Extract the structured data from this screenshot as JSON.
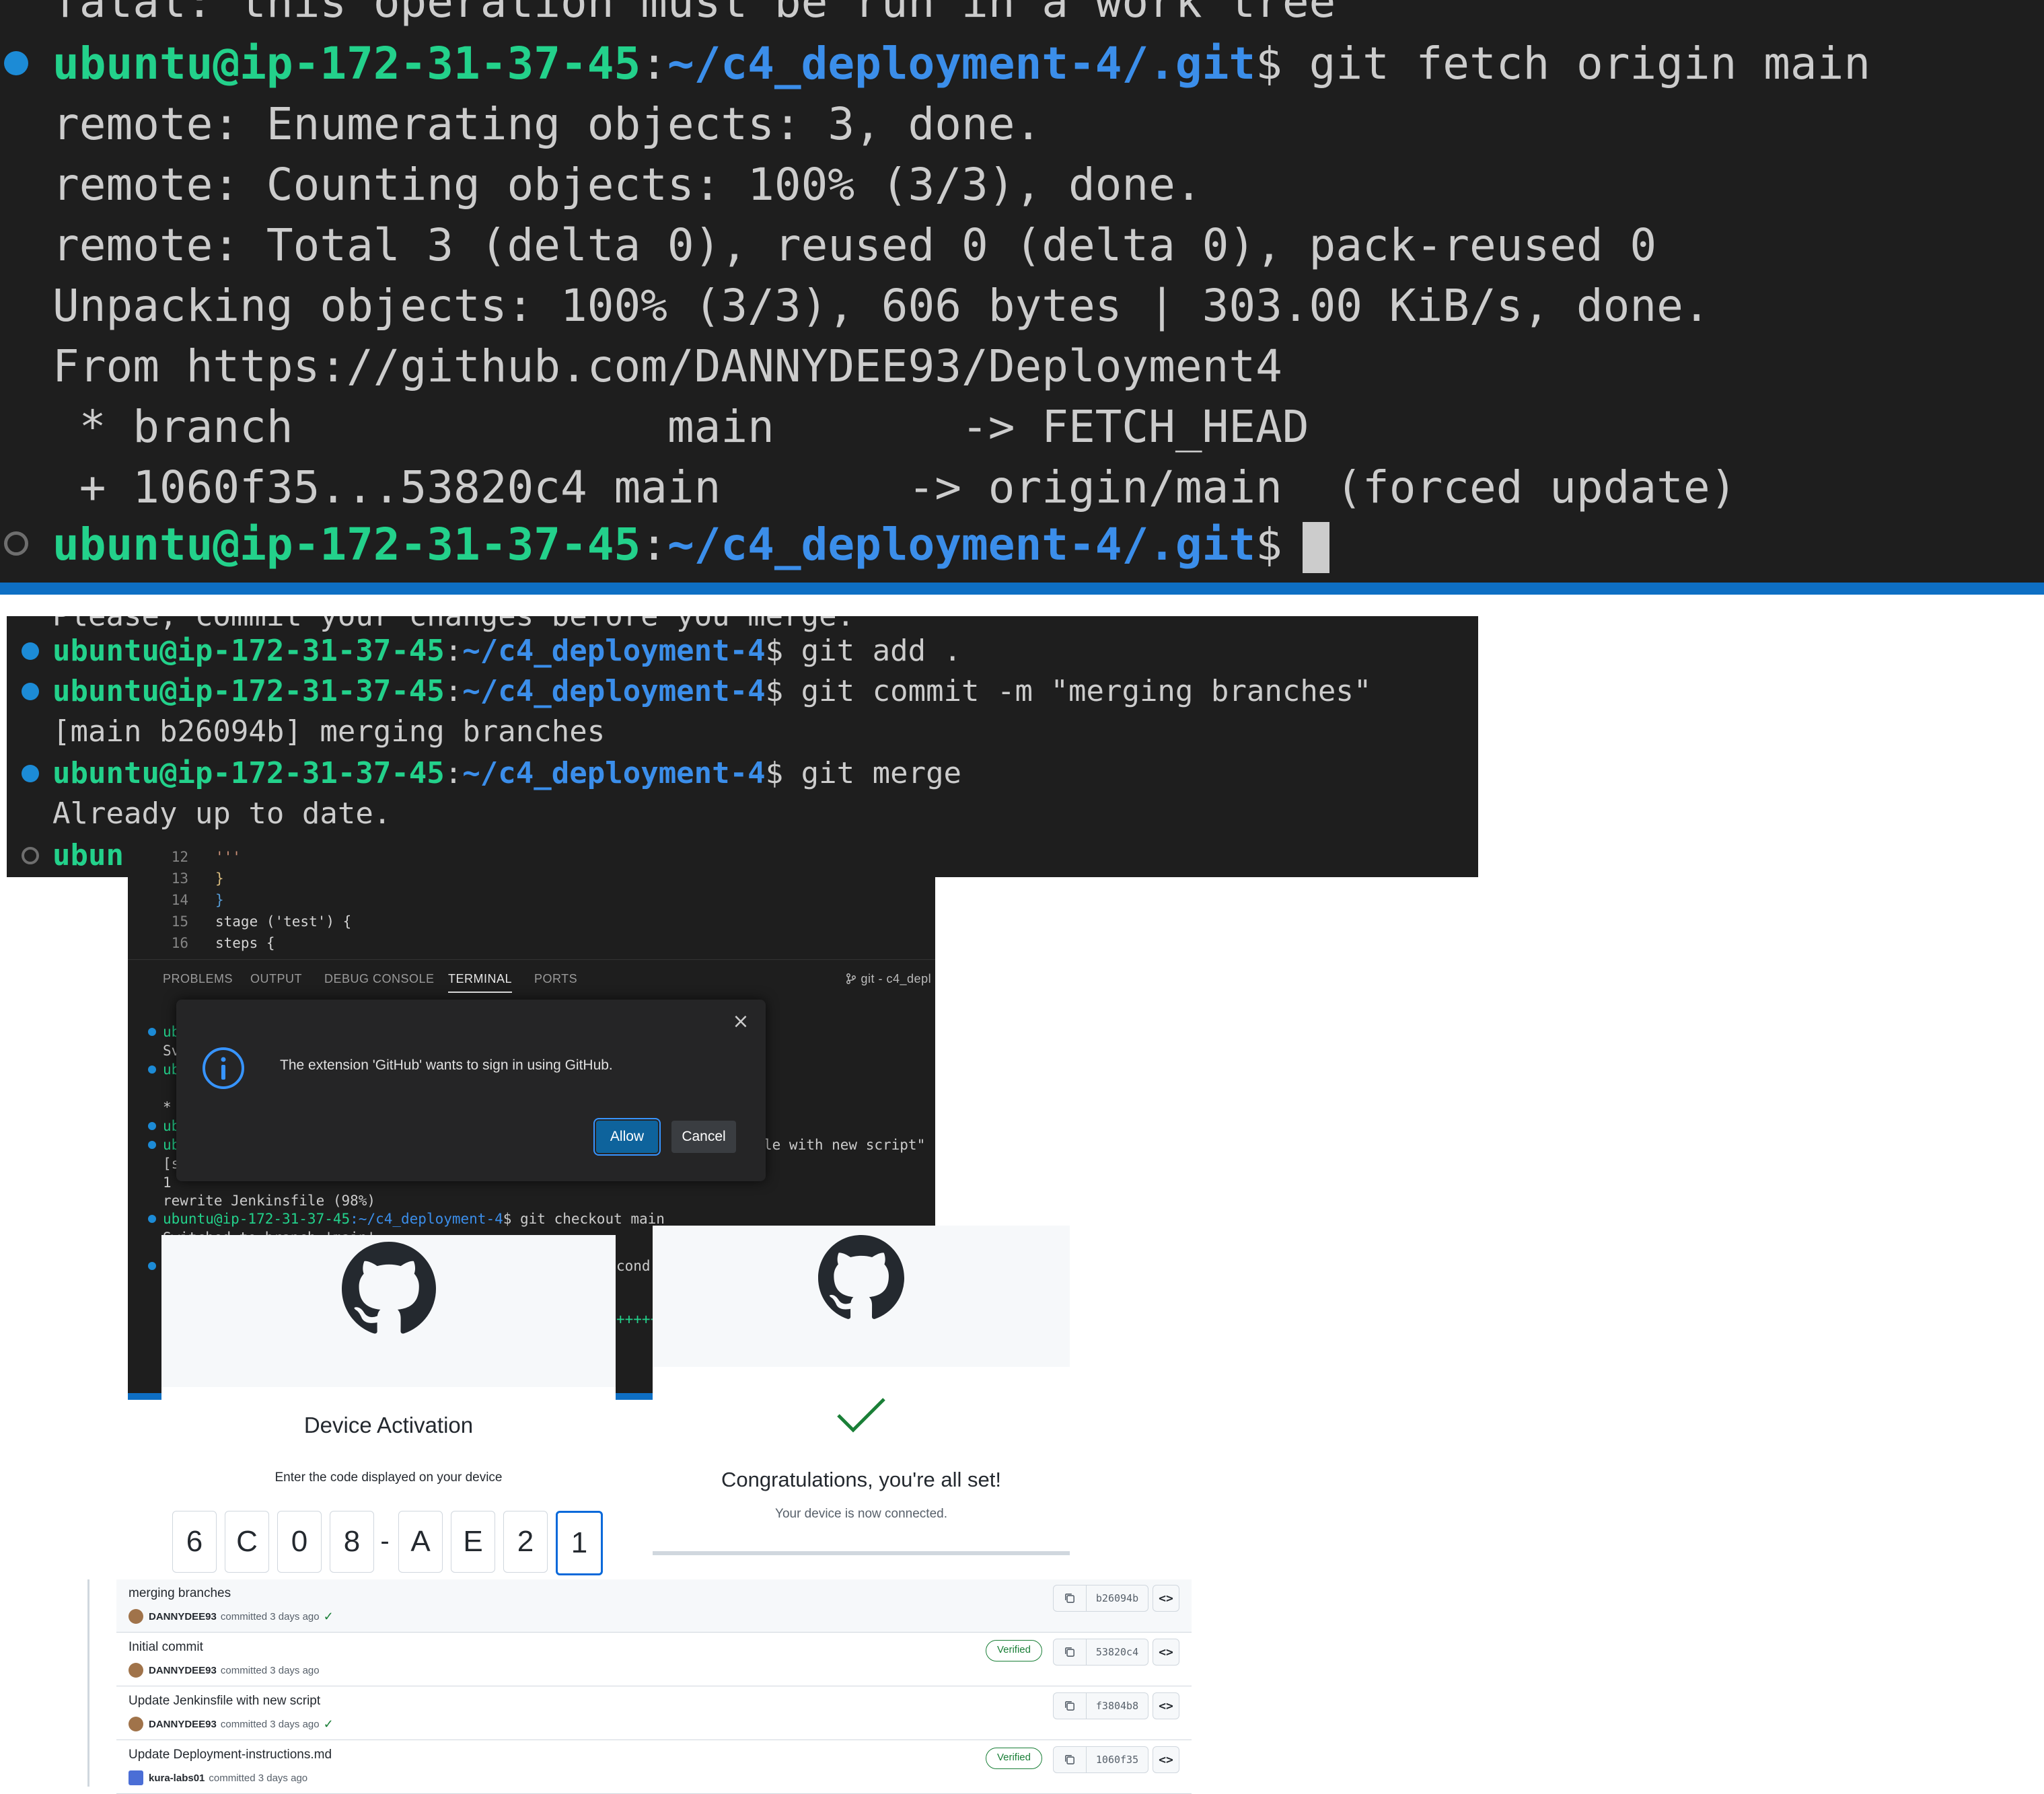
{
  "terminal1": {
    "partial_top_line": "fatal: this operation must be run in a work tree",
    "prompt_user": "ubuntu@ip-172-31-37-45",
    "prompt_path": "~/c4_deployment-4/.git",
    "prompt_symbol": "$",
    "command": " git fetch origin main",
    "output": [
      "remote: Enumerating objects: 3, done.",
      "remote: Counting objects: 100% (3/3), done.",
      "remote: Total 3 (delta 0), reused 0 (delta 0), pack-reused 0",
      "Unpacking objects: 100% (3/3), 606 bytes | 303.00 KiB/s, done.",
      "From https://github.com/DANNYDEE93/Deployment4",
      " * branch              main       -> FETCH_HEAD",
      " + 1060f35...53820c4 main       -> origin/main  (forced update)"
    ]
  },
  "terminal2": {
    "partial_top_line": "Please, commit your changes before you merge.",
    "prompt_user": "ubuntu@ip-172-31-37-45",
    "prompt_path": "~/c4_deployment-4",
    "prompt_symbol": "$",
    "cmd1": " git add .",
    "cmd2": " git commit -m \"merging branches\"",
    "out1": "[main b26094b] merging branches",
    "cmd3": " git merge",
    "out2": "Already up to date.",
    "last_partial": "ubun"
  },
  "editor": {
    "lines": [
      {
        "num": "12",
        "text": "'''"
      },
      {
        "num": "13",
        "text": "}"
      },
      {
        "num": "14",
        "text": "}"
      },
      {
        "num": "15",
        "text": "stage ('test') {"
      },
      {
        "num": "16",
        "text": "steps {"
      }
    ],
    "panel_tabs": [
      "PROBLEMS",
      "OUTPUT",
      "DEBUG CONSOLE",
      "TERMINAL",
      "PORTS"
    ],
    "active_tab": "TERMINAL",
    "terminal_name": "git - c4_depl",
    "terminal_lines": {
      "l1": "ub",
      "l2": "Sv",
      "l3": "ub",
      "l4": "*",
      "l5": "ub",
      "l6": "ub",
      "l7": "[s",
      "l8": "1",
      "tail_commit": "le with new script\"",
      "rewrite": "rewrite Jenkinsfile (98%)",
      "checkout_user": "ubuntu@ip-172-31-37-45",
      "checkout_path": ":~/c4_deployment-4",
      "checkout_cmd": "$ git checkout main",
      "switched": "Switched to branch 'main'",
      "cond": "cond",
      "plus": "+++++"
    }
  },
  "dialog": {
    "message": "The extension 'GitHub' wants to sign in using GitHub.",
    "allow_label": "Allow",
    "cancel_label": "Cancel",
    "close_glyph": "×",
    "info_icon": "info-icon"
  },
  "activation": {
    "title": "Device Activation",
    "subtitle": "Enter the code displayed on your device",
    "code": [
      "6",
      "C",
      "0",
      "8",
      "A",
      "E",
      "2",
      "1"
    ],
    "separator": "-"
  },
  "congrats": {
    "title": "Congratulations, you're all set!",
    "subtitle": "Your device is now connected."
  },
  "commits": [
    {
      "title": "merging branches",
      "author": "DANNYDEE93",
      "meta": "committed 3 days ago",
      "check": "✓",
      "verified": "",
      "sha": "b26094b"
    },
    {
      "title": "Initial commit",
      "author": "DANNYDEE93",
      "meta": "committed 3 days ago",
      "check": "",
      "verified": "Verified",
      "sha": "53820c4"
    },
    {
      "title": "Update Jenkinsfile with new script",
      "author": "DANNYDEE93",
      "meta": "committed 3 days ago",
      "check": "✓",
      "verified": "",
      "sha": "f3804b8"
    },
    {
      "title": "Update Deployment-instructions.md",
      "author": "kura-labs01",
      "meta": "committed 3 days ago",
      "check": "",
      "verified": "Verified",
      "sha": "1060f35"
    }
  ],
  "colors": {
    "terminal_bg": "#1e1e1e",
    "prompt_user": "#23d18b",
    "prompt_path": "#3b8eea",
    "accent_blue": "#0e6fc4",
    "verified_green": "#1a7f37"
  }
}
